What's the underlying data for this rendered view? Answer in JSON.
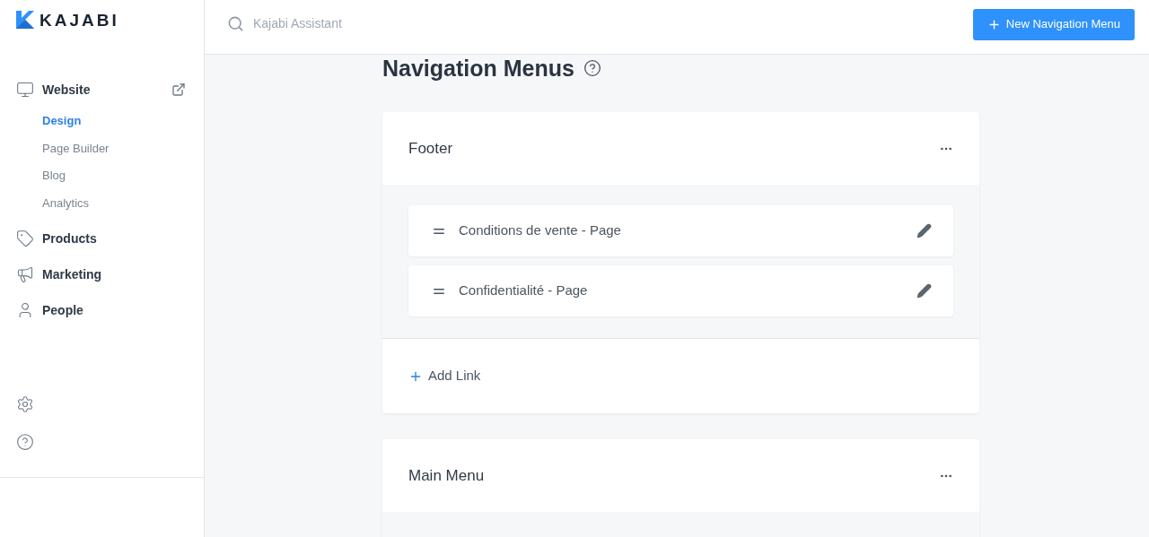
{
  "logo": {
    "text": "KAJABI"
  },
  "search": {
    "placeholder": "Kajabi Assistant"
  },
  "header_button": {
    "label": "New Navigation Menu"
  },
  "sidebar": {
    "items": [
      {
        "label": "Website",
        "external": true,
        "children": [
          {
            "label": "Design",
            "selected": true
          },
          {
            "label": "Page Builder",
            "selected": false
          },
          {
            "label": "Blog",
            "selected": false
          },
          {
            "label": "Analytics",
            "selected": false
          }
        ]
      },
      {
        "label": "Products"
      },
      {
        "label": "Marketing"
      },
      {
        "label": "People"
      }
    ]
  },
  "page": {
    "title": "Navigation Menus"
  },
  "menus": [
    {
      "name": "Footer",
      "links": [
        {
          "label": "Conditions de vente - Page"
        },
        {
          "label": "Confidentialité - Page"
        }
      ],
      "add_link": "Add Link"
    },
    {
      "name": "Main Menu"
    }
  ]
}
